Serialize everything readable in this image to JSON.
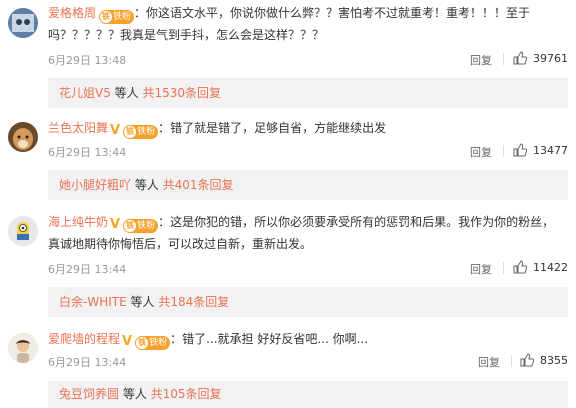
{
  "comments": [
    {
      "username": "爱格格周",
      "badge": "铁粉",
      "text_line1": "：你这语文水平，你说你做什么弊？？害怕考不过就重考！重考！！！至于",
      "text_line2": "吗？？？？？我真是气到手抖，怎么会是这样？？？",
      "time": "6月29日 13:48",
      "reply": "回复",
      "likes": "39761",
      "sub_user": "花儿姐V5",
      "sub_mid": " 等人 ",
      "sub_count": "共1530条回复"
    },
    {
      "username": "兰色太阳舞",
      "badge": "铁粉",
      "text_line1": "：错了就是错了，足够自省，方能继续出发",
      "time": "6月29日 13:44",
      "reply": "回复",
      "likes": "13477",
      "sub_user": "她小腿好粗吖",
      "sub_mid": " 等人 ",
      "sub_count": "共401条回复"
    },
    {
      "username": "海上纯牛奶",
      "badge": "铁粉",
      "text_line1": "：这是你犯的错，所以你必须要承受所有的惩罚和后果。我作为你的粉丝，",
      "text_line2": "真诚地期待你悔悟后，可以改过自新，重新出发。",
      "time": "6月29日 13:44",
      "reply": "回复",
      "likes": "11422",
      "sub_user": "白余-WHITE",
      "sub_mid": " 等人 ",
      "sub_count": "共184条回复"
    },
    {
      "username": "爱爬墙的程程",
      "badge": "铁粉",
      "text_line1": "：错了...就承担 好好反省吧... 你啊...",
      "time": "6月29日 13:44",
      "reply": "回复",
      "likes": "8355",
      "sub_user": "兔豆饲养圆",
      "sub_mid": " 等人 ",
      "sub_count": "共105条回复"
    }
  ]
}
